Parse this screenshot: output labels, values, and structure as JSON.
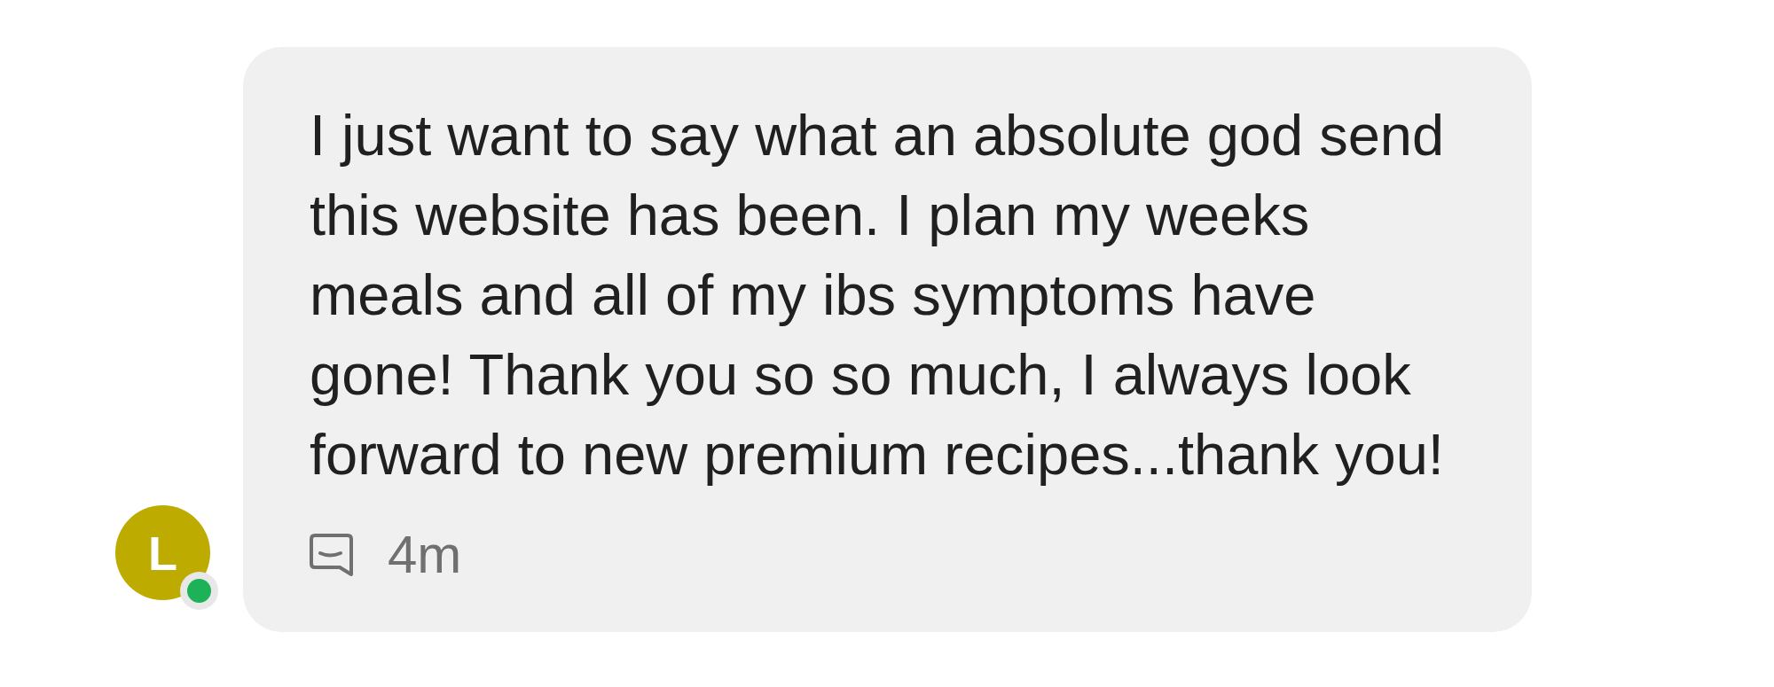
{
  "message": {
    "avatar": {
      "initial": "L",
      "online": true
    },
    "body": "I just want to say what an absolute god send this website has been. I plan my weeks meals and all of my ibs symptoms have gone! Thank you so so much, I always look forward to new premium recipes...thank you!",
    "time": "4m"
  }
}
